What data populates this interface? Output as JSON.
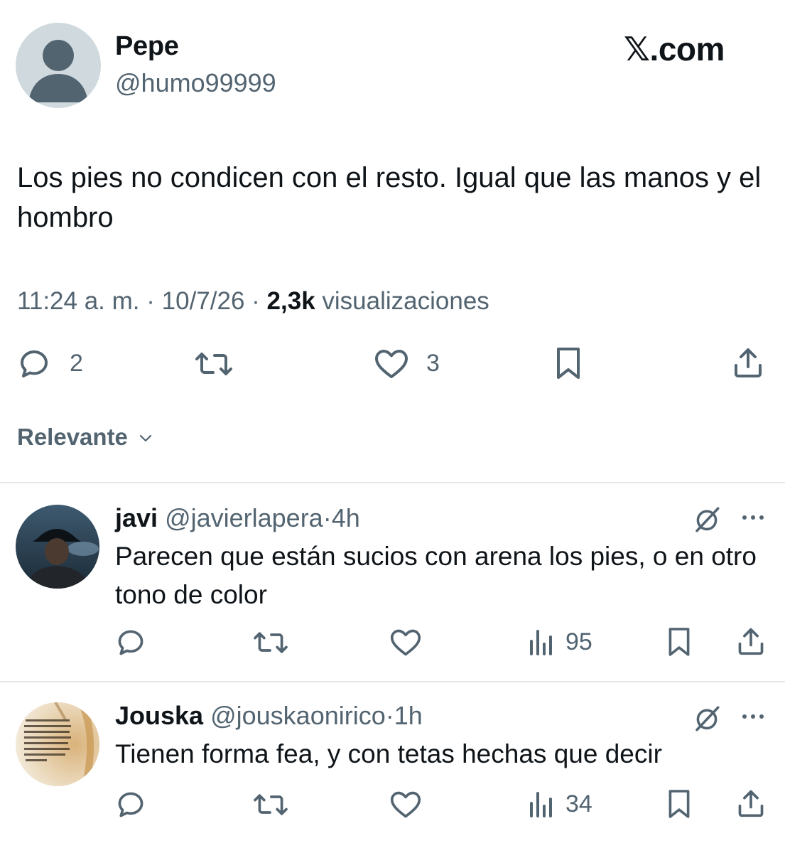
{
  "main_tweet": {
    "author_name": "Pepe",
    "author_handle": "@humo99999",
    "brand": "𝕏.com",
    "text": "Los pies no condicen con el resto. Igual que las manos y el hombro",
    "time": "11:24 a. m.",
    "date": "10/7/26",
    "views_count": "2,3k",
    "views_label": "visualizaciones",
    "separator": "·",
    "reply_count": "2",
    "like_count": "3"
  },
  "sort": {
    "label": "Relevante"
  },
  "replies": [
    {
      "name": "javi",
      "handle": "@javierlapera",
      "separator": "·",
      "age": "4h",
      "text": "Parecen que están sucios con arena los pies, o en otro tono de color",
      "views": "95"
    },
    {
      "name": "Jouska",
      "handle": "@jouskaonirico",
      "separator": "·",
      "age": "1h",
      "text": "Tienen forma fea, y con tetas hechas que decir",
      "views": "34",
      "avatar_text": "En la vida ni se gana ni se pierde, ni se fracasa ni se triunfa. En la vida se aprende, se descubre, se escribe, borra y reescribe; se hila, se deshila y se vuelve a hilar."
    }
  ],
  "colors": {
    "text_primary": "#0f1419",
    "text_secondary": "#536471",
    "divider": "#e4e8eb",
    "avatar_default": "#cfd9de"
  }
}
